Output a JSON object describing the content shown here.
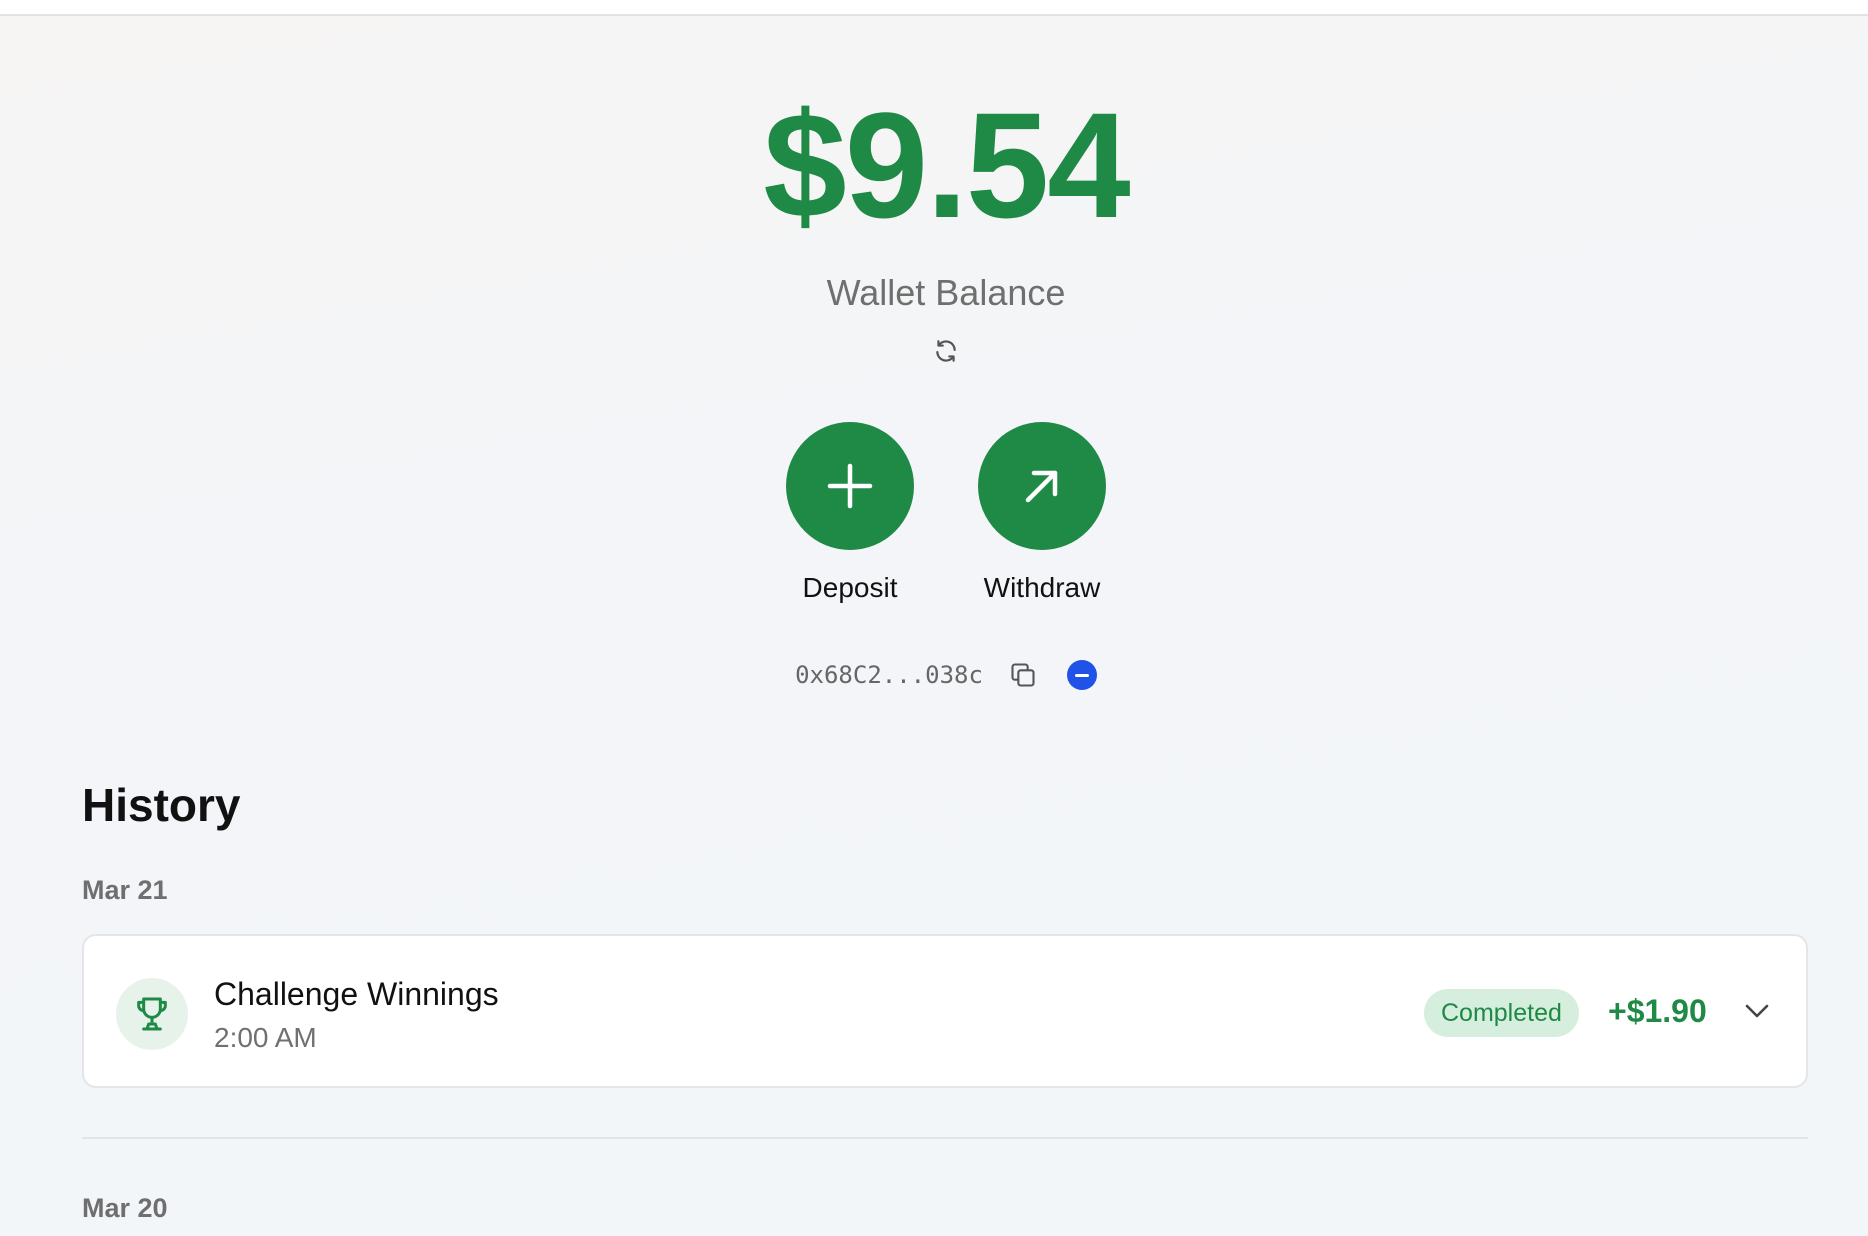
{
  "wallet": {
    "balance": "$9.54",
    "balance_label": "Wallet Balance",
    "refresh_icon": "refresh-icon",
    "accent_color": "#1f8a45"
  },
  "actions": {
    "deposit_label": "Deposit",
    "deposit_icon": "plus-icon",
    "withdraw_label": "Withdraw",
    "withdraw_icon": "arrow-up-right-icon"
  },
  "address": {
    "text": "0x68C2...038c",
    "copy_icon": "copy-icon",
    "network_icon": "network-icon",
    "network_color": "#2152e8"
  },
  "history": {
    "title": "History",
    "groups": [
      {
        "date": "Mar 21",
        "items": [
          {
            "icon": "trophy-icon",
            "title": "Challenge Winnings",
            "time": "2:00 AM",
            "status": "Completed",
            "amount": "+$1.90",
            "expand_icon": "chevron-down-icon"
          }
        ]
      },
      {
        "date": "Mar 20",
        "items": []
      }
    ]
  }
}
